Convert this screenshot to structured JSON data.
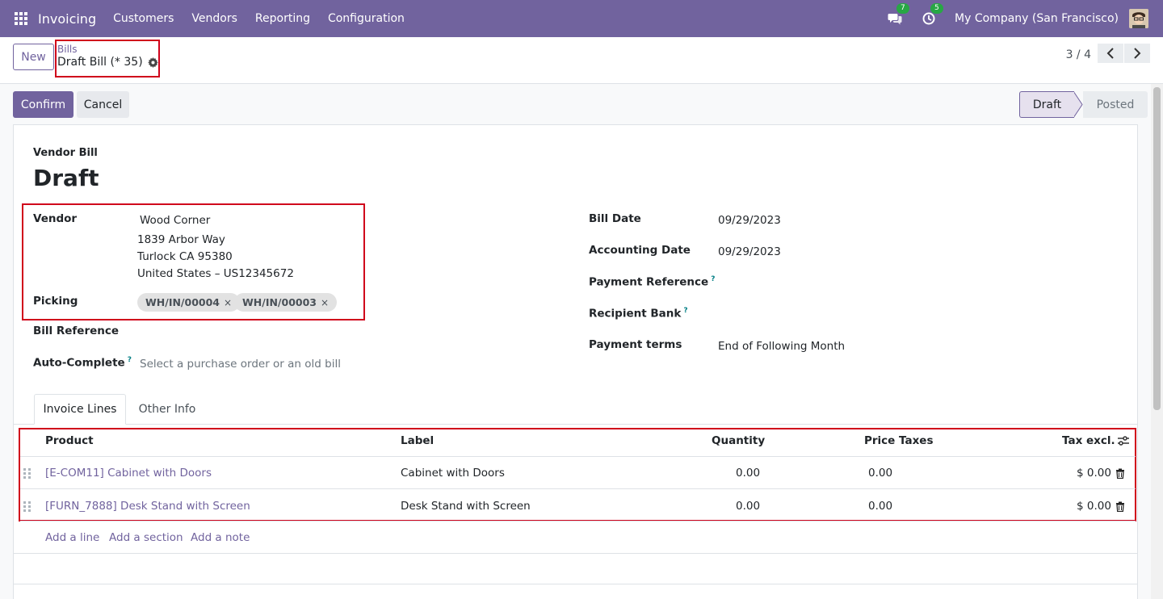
{
  "navbar": {
    "brand": "Invoicing",
    "menu": [
      "Customers",
      "Vendors",
      "Reporting",
      "Configuration"
    ],
    "messages_count": "7",
    "activities_count": "5",
    "company": "My Company (San Francisco)"
  },
  "control": {
    "new_label": "New",
    "breadcrumb_parent": "Bills",
    "breadcrumb_current": "Draft Bill (* 35)",
    "pager": "3 / 4"
  },
  "actions": {
    "confirm_label": "Confirm",
    "cancel_label": "Cancel"
  },
  "status": {
    "current": "Draft",
    "next": "Posted"
  },
  "form": {
    "type_label": "Vendor Bill",
    "title": "Draft",
    "vendor_label": "Vendor",
    "vendor_name": "Wood Corner",
    "vendor_address_1": "1839 Arbor Way",
    "vendor_address_2": "Turlock CA 95380",
    "vendor_address_3": "United States – US12345672",
    "picking_label": "Picking",
    "pickings": [
      "WH/IN/00004",
      "WH/IN/00003"
    ],
    "bill_reference_label": "Bill Reference",
    "auto_complete_label": "Auto-Complete",
    "auto_complete_placeholder": "Select a purchase order or an old bill",
    "bill_date_label": "Bill Date",
    "bill_date": "09/29/2023",
    "accounting_date_label": "Accounting Date",
    "accounting_date": "09/29/2023",
    "payment_reference_label": "Payment Reference",
    "recipient_bank_label": "Recipient Bank",
    "payment_terms_label": "Payment terms",
    "payment_terms": "End of Following Month",
    "help_mark": "?"
  },
  "tabs": [
    "Invoice Lines",
    "Other Info"
  ],
  "table": {
    "headers": {
      "product": "Product",
      "label": "Label",
      "quantity": "Quantity",
      "price": "Price",
      "taxes": "Taxes",
      "tax_excl": "Tax excl."
    },
    "rows": [
      {
        "product": "[E-COM11] Cabinet with Doors",
        "label": "Cabinet with Doors",
        "quantity": "0.00",
        "price": "0.00",
        "taxes": "",
        "tax_excl": "$ 0.00"
      },
      {
        "product": "[FURN_7888] Desk Stand with Screen",
        "label": "Desk Stand with Screen",
        "quantity": "0.00",
        "price": "0.00",
        "taxes": "",
        "tax_excl": "$ 0.00"
      }
    ],
    "add_line": "Add a line",
    "add_section": "Add a section",
    "add_note": "Add a note"
  },
  "colors": {
    "brand": "#71639e",
    "highlight": "#d0021b",
    "badge": "#28a745"
  }
}
